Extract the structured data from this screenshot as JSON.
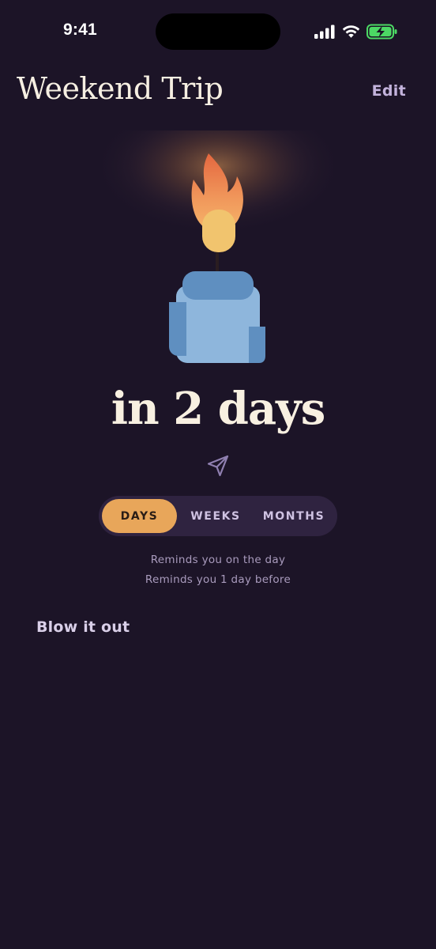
{
  "status_bar": {
    "time": "9:41",
    "icons": [
      "signal-icon",
      "wifi-icon",
      "battery-charging-icon"
    ]
  },
  "header": {
    "title": "Weekend Trip",
    "edit_label": "Edit"
  },
  "illustration": {
    "name": "candle-with-flame",
    "colors": {
      "flame_outer": "#e98a4d",
      "flame_inner": "#f7c06a",
      "glow": "#8a5a3a",
      "candle_body": "#8eb6dc",
      "candle_top": "#5f8fc0",
      "background": "#1c1427"
    }
  },
  "countdown": {
    "text": "in 2 days"
  },
  "share": {
    "icon": "send-icon"
  },
  "unit_selector": {
    "options": [
      "DAYS",
      "WEEKS",
      "MONTHS"
    ],
    "selected": "DAYS"
  },
  "reminders": [
    "Reminds you on the day",
    "Reminds you 1 day before"
  ],
  "actions": {
    "blow_out_label": "Blow it out"
  },
  "colors": {
    "accent": "#e8a65a",
    "background": "#1c1427",
    "segment_bg": "#2f2340",
    "muted_text": "#a99bbd"
  }
}
